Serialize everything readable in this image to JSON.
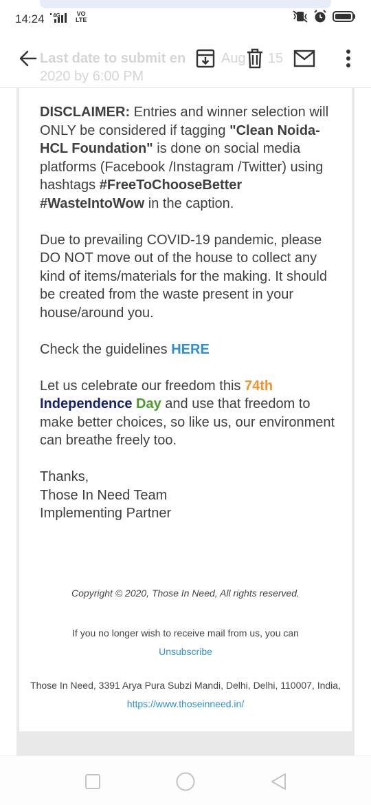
{
  "status": {
    "time": "14:24",
    "network": "4G",
    "volte_line1": "VO",
    "volte_line2": "LTE"
  },
  "header": {
    "subject_line1": "Last date to submit en",
    "subject_date": "August 15",
    "subject_line2": "2020 by 6:00 PM"
  },
  "email": {
    "disclaimer_label": "DISCLAIMER:",
    "disclaimer_text1": " Entries and winner selection will ONLY be considered if tagging ",
    "disclaimer_tag": "\"Clean Noida- HCL Foundation\"",
    "disclaimer_text2": " is done on social media platforms (Facebook /Instagram /Twitter) using hashtags ",
    "hashtags": "#FreeToChooseBetter #WasteIntoWow",
    "disclaimer_text3": " in the caption.",
    "covid_text": "Due to prevailing COVID-19 pandemic, please DO NOT move out of the house to collect any kind of items/materials for the making. It should be created from the waste present in your house/around you.",
    "guidelines_text": "Check the guidelines ",
    "guidelines_link": "HERE",
    "celebrate_text1": "Let us celebrate our freedom this ",
    "celebrate_74th": "74th",
    "celebrate_independence": "Independence",
    "celebrate_day": "Day",
    "celebrate_text2": " and use that freedom to make better choices, so like us, our environment can breathe freely too.",
    "sign_thanks": "Thanks,",
    "sign_team": "Those In Need Team",
    "sign_role": "Implementing Partner"
  },
  "footer": {
    "copyright": "Copyright © 2020, Those In Need, All rights reserved.",
    "unsub_text": "If you no longer wish to receive mail from us, you can",
    "unsub_link": "Unsubscribe",
    "address": "Those In Need, 3391 Arya Pura Subzi Mandi, Delhi, Delhi, 110007, India, ",
    "website": "https://www.thoseinneed.in/"
  },
  "colors": {
    "link": "#2f8fce",
    "orange": "#f4922a",
    "navy": "#16206b",
    "green": "#4a9a2a"
  },
  "icons": [
    "back-arrow-icon",
    "archive-icon",
    "delete-icon",
    "mail-icon",
    "more-vert-icon",
    "vibrate-icon",
    "alarm-icon",
    "battery-icon",
    "signal-icon",
    "nav-recents-icon",
    "nav-home-icon",
    "nav-back-icon"
  ]
}
